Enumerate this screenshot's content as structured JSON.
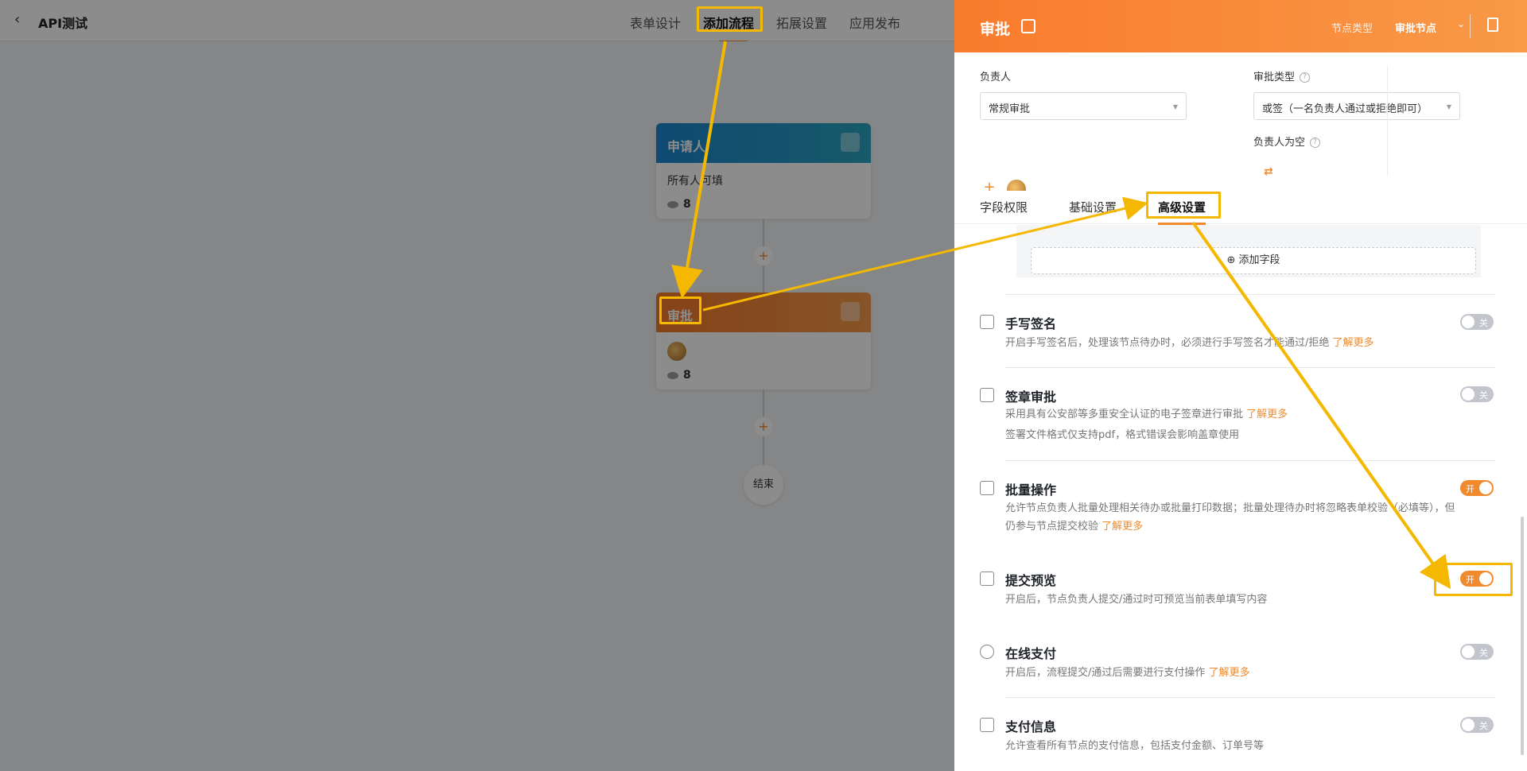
{
  "app": {
    "title": "API测试"
  },
  "top_tabs": [
    {
      "label": "表单设计"
    },
    {
      "label": "添加流程"
    },
    {
      "label": "拓展设置"
    },
    {
      "label": "应用发布"
    }
  ],
  "flow": {
    "applicant": {
      "title": "申请人",
      "desc": "所有人可填",
      "count": "8",
      "color": "#1f8fd0"
    },
    "approval": {
      "title": "审批",
      "count": "8",
      "color": "#f07a2b"
    },
    "end_label": "结束",
    "plus": "+"
  },
  "drawer": {
    "title": "审批",
    "node_type_label": "节点类型",
    "node_type_value": "审批节点",
    "owner_label": "负责人",
    "owner_select": "常规审批",
    "approval_type_label": "审批类型",
    "approval_type_select": "或签（一名负责人通过或拒绝即可）",
    "empty_owner_label": "负责人为空",
    "subtabs": [
      {
        "label": "字段权限"
      },
      {
        "label": "基础设置"
      },
      {
        "label": "高级设置"
      }
    ],
    "add_field": "⊕ 添加字段",
    "settings": [
      {
        "title": "手写签名",
        "desc": [
          "开启手写签名后，处理该节点待办时，必须进行手写签名才能通过/拒绝"
        ],
        "link": "了解更多",
        "enabled": false,
        "toggle_text": "关"
      },
      {
        "title": "签章审批",
        "desc": [
          "采用具有公安部等多重安全认证的电子签章进行审批",
          "签署文件格式仅支持pdf，格式错误会影响盖章使用"
        ],
        "link": "了解更多",
        "enabled": false,
        "toggle_text": "关"
      },
      {
        "title": "批量操作",
        "desc": [
          "允许节点负责人批量处理相关待办或批量打印数据；批量处理待办时将忽略表单校验（必填等），但",
          "仍参与节点提交校验"
        ],
        "link": "了解更多",
        "enabled": true,
        "toggle_text": "开"
      },
      {
        "title": "提交预览",
        "desc": [
          "开启后，节点负责人提交/通过时可预览当前表单填写内容"
        ],
        "link": "",
        "enabled": true,
        "toggle_text": "开"
      },
      {
        "title": "在线支付",
        "desc": [
          "开启后，流程提交/通过后需要进行支付操作"
        ],
        "link": "了解更多",
        "enabled": false,
        "toggle_text": "关"
      },
      {
        "title": "支付信息",
        "desc": [
          "允许查看所有节点的支付信息，包括支付金额、订单号等"
        ],
        "link": "",
        "enabled": false,
        "toggle_text": "关"
      }
    ]
  },
  "colors": {
    "accent": "#f08a2d",
    "highlight": "#f5b800"
  }
}
